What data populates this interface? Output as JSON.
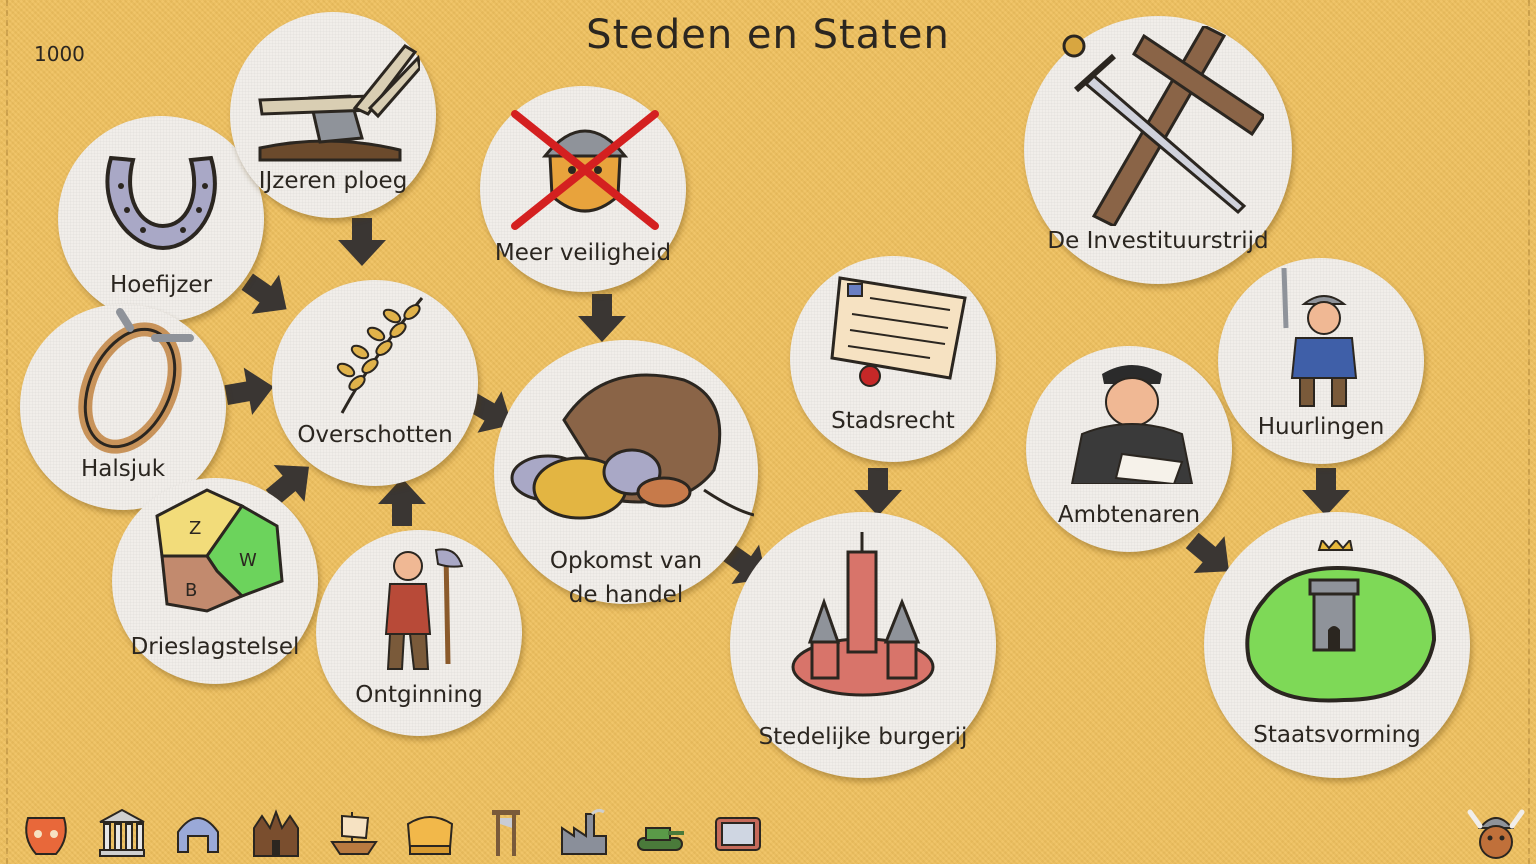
{
  "title": "Steden en Staten",
  "year": "1000",
  "nodes": {
    "hoefijzer": "Hoefijzer",
    "ijzeren_ploeg": "IJzeren ploeg",
    "halsjuk": "Halsjuk",
    "overschotten": "Overschotten",
    "drieslagstelsel": "Drieslagstelsel",
    "ontginning": "Ontginning",
    "meer_veiligheid": "Meer veiligheid",
    "opkomst_line1": "Opkomst van",
    "opkomst_line2": "de handel",
    "stadsrecht": "Stadsrecht",
    "stedelijke_burgerij": "Stedelijke burgerij",
    "investituurstrijd": "De Investituurstrijd",
    "ambtenaren": "Ambtenaren",
    "huurlingen": "Huurlingen",
    "staatsvorming": "Staatsvorming"
  },
  "field_letters": {
    "z": "Z",
    "w": "W",
    "b": "B"
  },
  "toolbar": {
    "icons": [
      "pottery-icon",
      "temple-icon",
      "helmet-icon",
      "castle-icon",
      "ship-icon",
      "crown-icon",
      "guillotine-icon",
      "factory-icon",
      "tank-icon",
      "television-icon"
    ],
    "mascot": "viking-mascot-icon"
  },
  "colors": {
    "background": "#f0c15f",
    "circle": "#f1eeea",
    "arrow": "#3a3633",
    "land_green": "#7ed957"
  }
}
